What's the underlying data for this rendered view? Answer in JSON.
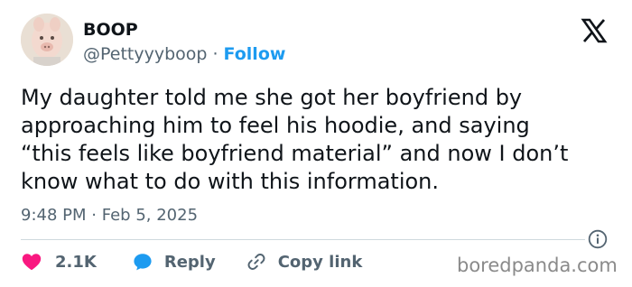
{
  "author": {
    "display_name": "BOOP",
    "handle": "@Pettyyyboop",
    "separator": "·",
    "follow_label": "Follow",
    "avatar_icon": "avatar-photo"
  },
  "platform_icon": "x-logo-icon",
  "tweet": {
    "text": "My daughter told me she got her boyfriend by\napproaching him to feel his hoodie, and saying\n“this feels like boyfriend material” and now I don’t\nknow what to do with this information.",
    "time": "9:48 PM",
    "separator": "·",
    "date": "Feb 5, 2025"
  },
  "actions": {
    "like_count": "2.1K",
    "reply_label": "Reply",
    "copy_label": "Copy link"
  },
  "watermark": "boredpanda.com",
  "colors": {
    "text": "#0f1419",
    "muted": "#536471",
    "accent": "#1d9bf0",
    "like": "#f91880",
    "divider": "#cfd9de"
  }
}
